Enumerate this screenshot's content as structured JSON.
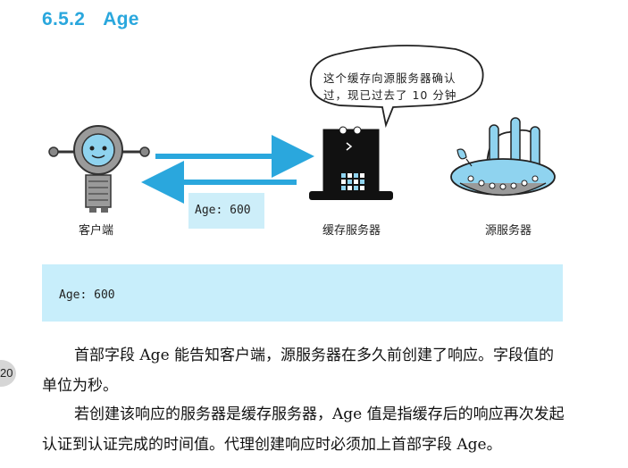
{
  "heading": {
    "number": "6.5.2",
    "title": "Age"
  },
  "illustration": {
    "speech_bubble": {
      "line1": "这个缓存向源服务器确认",
      "line2": "过，现已过去了 10 分钟"
    },
    "labels": {
      "client": "客户端",
      "cache_server": "缓存服务器",
      "origin_server": "源服务器"
    },
    "age_tag": "Age: 600"
  },
  "code_block": "Age: 600",
  "page_number": "20",
  "paragraphs": [
    "首部字段 Age 能告知客户端，源服务器在多久前创建了响应。字段值的单位为秒。",
    "若创建该响应的服务器是缓存服务器，Age 值是指缓存后的响应再次发起认证到认证完成的时间值。代理创建响应时必须加上首部字段 Age。"
  ],
  "colors": {
    "accent": "#2aa7dd",
    "highlight": "#c8eefb"
  }
}
